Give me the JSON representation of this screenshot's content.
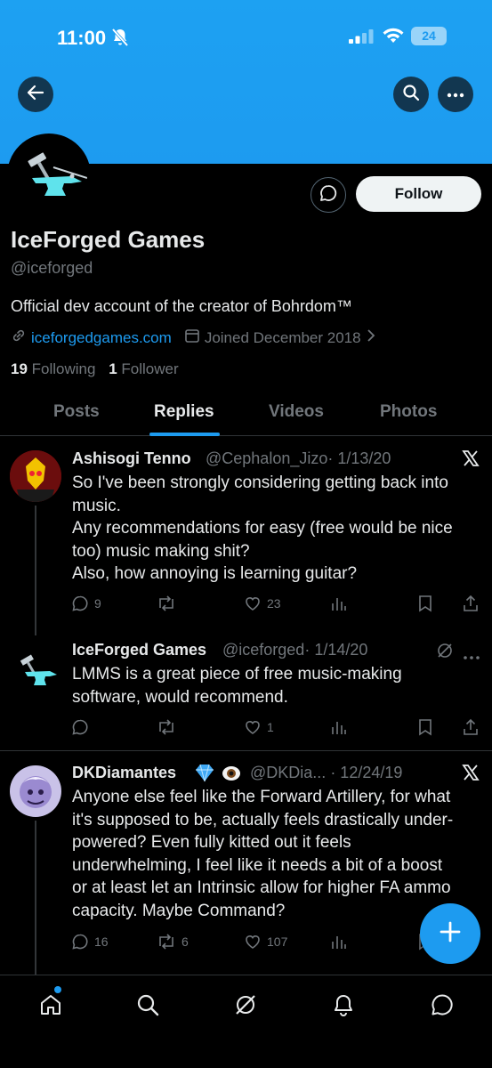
{
  "status_bar": {
    "time": "11:00",
    "battery": "24"
  },
  "profile": {
    "display_name": "IceForged Games",
    "handle": "@iceforged",
    "bio": "Official dev account of the creator of Bohrdom™",
    "website": "iceforgedgames.com",
    "joined": "Joined December 2018",
    "following_count": "19",
    "following_label": "Following",
    "followers_count": "1",
    "followers_label": "Follower",
    "follow_label": "Follow"
  },
  "tabs": [
    {
      "label": "Posts"
    },
    {
      "label": "Replies"
    },
    {
      "label": "Videos"
    },
    {
      "label": "Photos"
    }
  ],
  "tweets": [
    {
      "name": "Ashisogi Tenno",
      "handle": "@Cephalon_Jizo",
      "date": "· 1/13/20",
      "lines": [
        "So I've been strongly considering getting back into",
        "music.",
        "Any recommendations for easy (free would be nice",
        "too) music making shit?",
        "Also, how annoying is learning guitar?"
      ],
      "replies": "9",
      "retweets": "",
      "likes": "23"
    },
    {
      "name": "IceForged Games",
      "handle": "@iceforged",
      "date": "· 1/14/20",
      "lines": [
        "LMMS is a great piece of free music-making",
        "software, would recommend."
      ],
      "replies": "",
      "retweets": "",
      "likes": "1"
    },
    {
      "name": "DKDiamantes",
      "handle": "@DKDia...",
      "date": "· 12/24/19",
      "lines": [
        "Anyone else feel like the Forward Artillery, for what",
        "it's supposed to be, actually feels drastically under-",
        "powered? Even fully kitted out it feels",
        "underwhelming, I feel like it needs a bit of a boost",
        "or at least let an Intrinsic allow for higher FA ammo",
        "capacity. Maybe Command?"
      ],
      "replies": "16",
      "retweets": "6",
      "likes": "107"
    }
  ],
  "colors": {
    "accent": "#1d9bf0",
    "background": "#000000",
    "muted": "#71767b",
    "text": "#e7e9ea"
  }
}
